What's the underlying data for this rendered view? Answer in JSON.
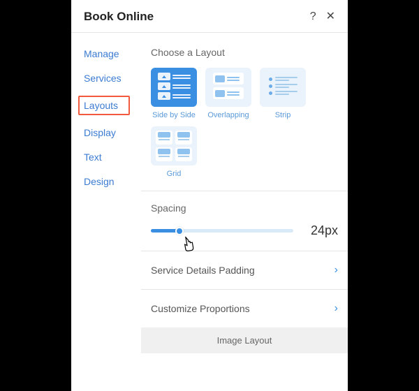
{
  "header": {
    "title": "Book Online"
  },
  "sidebar": {
    "items": [
      {
        "label": "Manage"
      },
      {
        "label": "Services"
      },
      {
        "label": "Layouts",
        "selected": true
      },
      {
        "label": "Display"
      },
      {
        "label": "Text"
      },
      {
        "label": "Design"
      }
    ]
  },
  "main": {
    "choose_title": "Choose a Layout",
    "layouts": [
      {
        "label": "Side by Side"
      },
      {
        "label": "Overlapping"
      },
      {
        "label": "Strip"
      },
      {
        "label": "Grid"
      }
    ],
    "spacing": {
      "title": "Spacing",
      "value": "24px"
    },
    "expand1": "Service Details Padding",
    "expand2": "Customize Proportions",
    "footer": "Image Layout"
  }
}
